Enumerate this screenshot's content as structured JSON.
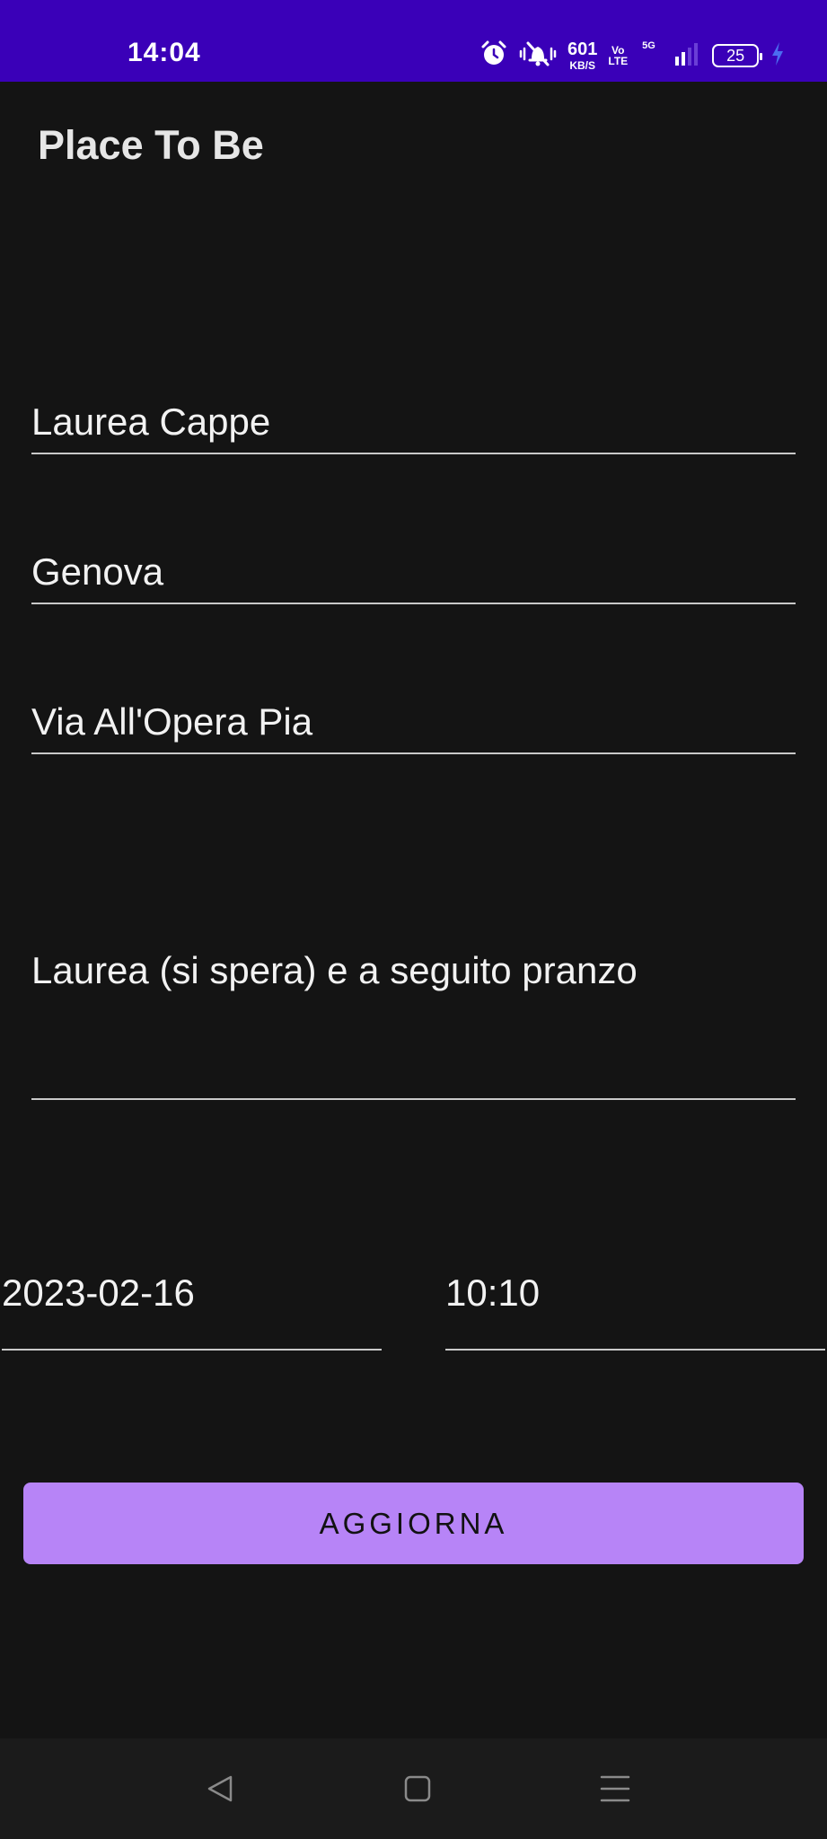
{
  "status_bar": {
    "time": "14:04",
    "net_speed_value": "601",
    "net_speed_unit": "KB/S",
    "volte_top": "Vo",
    "volte_bottom": "LTE",
    "network_type": "5G",
    "battery_level": "25",
    "icons": [
      "alarm-icon",
      "mute-icon",
      "signal-icon",
      "battery-icon",
      "charging-icon"
    ],
    "background_color": "#3a00b8"
  },
  "app": {
    "title": "Place To Be"
  },
  "form": {
    "name_value": "Laurea Cappe",
    "city_value": "Genova",
    "address_value": "Via All'Opera Pia",
    "description_value": "Laurea (si spera) e a seguito pranzo",
    "date_value": "2023-02-16",
    "time_value": "10:10"
  },
  "actions": {
    "update_label": "AGGIORNA",
    "button_color": "#b784f7"
  },
  "nav_bar": {
    "icons": [
      "back-icon",
      "home-icon",
      "menu-icon"
    ]
  }
}
